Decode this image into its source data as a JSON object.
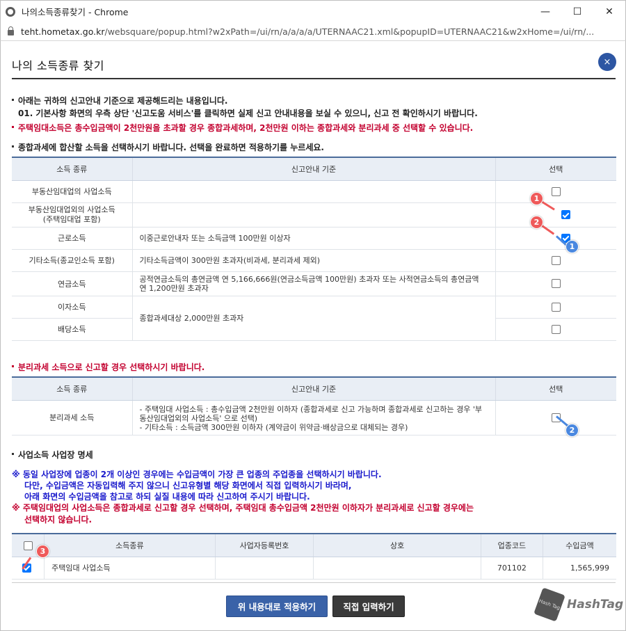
{
  "window": {
    "title": "나의소득종류찾기 - Chrome",
    "url_domain": "teht.hometax.go.kr",
    "url_path": "/websquare/popup.html?w2xPath=/ui/rn/a/a/a/a/UTERNAAC21.xml&popupID=UTERNAAC21&w2xHome=/ui/rn/..."
  },
  "popup": {
    "title": "나의 소득종류 찾기",
    "close_label": "×"
  },
  "intro": {
    "line1": "아래는 귀하의 신고안내 기준으로 제공해드리는 내용입니다.",
    "line2": "01. 기본사항 화면의 우측 상단 '신고도움 서비스'를 클릭하면 실제 신고 안내내용을 보실 수 있으니, 신고 전 확인하시기 바랍니다.",
    "line3": "주택임대소득은 총수입금액이 2천만원을 초과할 경우 종합과세하며, 2천만원 이하는 종합과세와 분리과세 중 선택할 수 있습니다."
  },
  "section1": {
    "heading": "종합과세에 합산할 소득을 선택하시기 바랍니다. 선택을 완료하면 적용하기를 누르세요.",
    "headers": [
      "소득 종류",
      "신고안내 기준",
      "선택"
    ],
    "rows": [
      {
        "type": "부동산임대업의 사업소득",
        "criteria": "",
        "checked": false
      },
      {
        "type": "부동산임대업외의 사업소득\n(주택임대업 포함)",
        "criteria": "",
        "checked": true
      },
      {
        "type": "근로소득",
        "criteria": "이중근로안내자 또는 소득금액 100만원 이상자",
        "checked": true
      },
      {
        "type": "기타소득(종교인소득 포함)",
        "criteria": "기타소득금액이 300만원 초과자(비과세, 분리과세 제외)",
        "checked": false
      },
      {
        "type": "연금소득",
        "criteria": "공적연금소득의 총연금액 연 5,166,666원(연금소득금액 100만원) 초과자 또는 사적연금소득의 총연금액 연 1,200만원 초과자",
        "checked": false
      },
      {
        "type": "이자소득",
        "criteria": "종합과세대상 2,000만원 초과자",
        "checked": false
      },
      {
        "type": "배당소득",
        "criteria": "",
        "checked": false
      }
    ]
  },
  "section2": {
    "heading": "분리과세 소득으로 신고할 경우 선택하시기 바랍니다.",
    "headers": [
      "소득 종류",
      "신고안내 기준",
      "선택"
    ],
    "row": {
      "type": "분리과세 소득",
      "criteria_1": "- 주택임대 사업소득 : 총수입금액 2천만원 이하자 (종합과세로 신고 가능하며 종합과세로 신고하는 경우 '부동산임대업외의 사업소득' 으로 선택)",
      "criteria_2": "- 기타소득 : 소득금액 300만원 이하자 (계약금이 위약금·배상금으로 대체되는 경우)",
      "checked": false
    }
  },
  "section3": {
    "heading": "사업소득 사업장 명세",
    "note_blue_1": "※ 동일 사업장에 업종이 2개 이상인 경우에는 수입금액이 가장 큰 업종의 주업종을 선택하시기 바랍니다.",
    "note_blue_2": "다만, 수입금액은 자동입력해 주지 않으니 신고유형별 해당 화면에서 직접 입력하시기 바라며,",
    "note_blue_3": "아래 화면의 수입금액을 참고로 하되 실질 내용에 따라 신고하여 주시기 바랍니다.",
    "note_red_1": "※ 주택임대업의 사업소득은 종합과세로 신고할 경우 선택하며, 주택임대 총수입금액 2천만원 이하자가 분리과세로 신고할 경우에는",
    "note_red_2": "선택하지 않습니다.",
    "headers": [
      "",
      "소득종류",
      "사업자등록번호",
      "상호",
      "업종코드",
      "수입금액"
    ],
    "row": {
      "checked": true,
      "type": "주택임대 사업소득",
      "reg_no": "",
      "name": "",
      "code": "701102",
      "amount": "1,565,999"
    }
  },
  "buttons": {
    "apply": "위 내용대로 적용하기",
    "direct": "직접 입력하기"
  },
  "annotations": {
    "m1": "1",
    "m2": "2",
    "m1b": "1",
    "m2b": "2",
    "m3": "3"
  },
  "watermark": {
    "text": "HashTag",
    "logo_text": "Hash Tag"
  }
}
